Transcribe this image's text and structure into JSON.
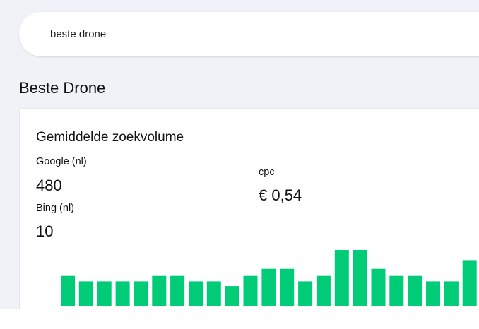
{
  "search": {
    "value": "beste drone"
  },
  "page": {
    "title": "Beste Drone"
  },
  "volume_card": {
    "title": "Gemiddelde zoekvolume",
    "google_label": "Google (nl)",
    "google_value": "480",
    "bing_label": "Bing (nl)",
    "bing_value": "10",
    "cpc_label": "cpc",
    "cpc_value": "€ 0,54"
  },
  "colors": {
    "background": "#f1f2f7",
    "card": "#ffffff",
    "bar": "#00cc77"
  },
  "chart_data": {
    "type": "bar",
    "categories": [],
    "values": [
      390,
      320,
      320,
      320,
      320,
      390,
      390,
      320,
      320,
      260,
      390,
      480,
      480,
      320,
      390,
      720,
      720,
      480,
      390,
      390,
      320,
      320,
      590
    ],
    "ylim": [
      0,
      720
    ],
    "grid": false,
    "color": "#00cc77"
  }
}
